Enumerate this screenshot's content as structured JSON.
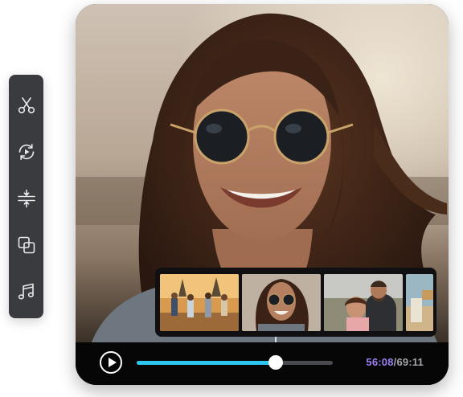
{
  "toolbar": {
    "tools": [
      {
        "icon": "scissors-icon",
        "action": "cut"
      },
      {
        "icon": "rotate-play-icon",
        "action": "rotate"
      },
      {
        "icon": "split-icon",
        "action": "split"
      },
      {
        "icon": "overlay-icon",
        "action": "overlay"
      },
      {
        "icon": "music-note-icon",
        "action": "music"
      }
    ]
  },
  "player": {
    "current_time": "56:08",
    "separator": "/",
    "total_time": "69:11",
    "progress": 0.708,
    "play_icon": "play-icon"
  },
  "thumbnails": [
    {
      "name": "thumbnail-group-walking"
    },
    {
      "name": "thumbnail-woman-sunglasses"
    },
    {
      "name": "thumbnail-couple"
    },
    {
      "name": "thumbnail-partial"
    }
  ],
  "colors": {
    "accent_progress": "#2ec5ef",
    "time_current": "#9f7ff3",
    "toolbar_bg": "#3a3b3e",
    "control_bg": "#060607"
  }
}
